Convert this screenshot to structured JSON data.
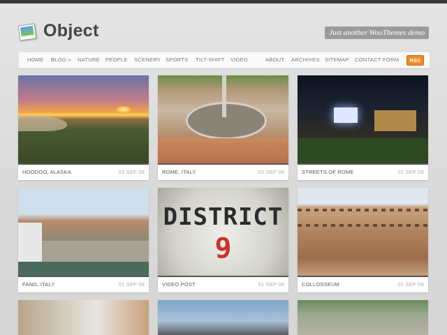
{
  "site": {
    "title": "Object",
    "tagline": "Just another WooThemes demo"
  },
  "nav": {
    "left": [
      "HOME",
      "BLOG »",
      "NATURE",
      "PEOPLE",
      "SCENERY",
      "SPORTS",
      "TILT-SHIFT",
      "VIDEO"
    ],
    "right": [
      "ABOUT",
      "ARCHIVES",
      "SITEMAP",
      "CONTACT FORM"
    ],
    "rss_label": "RSS"
  },
  "posts": [
    {
      "title": "HOODOO, ALASKA",
      "date": "03 SEP 09"
    },
    {
      "title": "ROME, ITALY",
      "date": "02 SEP 09"
    },
    {
      "title": "STREETS OF ROME",
      "date": "01 SEP 09"
    },
    {
      "title": "FANO, ITALY",
      "date": "01 SEP 09"
    },
    {
      "title": "VIDEO POST",
      "date": "01 SEP 09"
    },
    {
      "title": "COLLOSSEUM",
      "date": "01 SEP 09"
    }
  ],
  "video_thumb": {
    "line1": "DISTRICT",
    "line2": "9"
  },
  "colors": {
    "accent_rss": "#f08a24",
    "tagline_bg": "#9b9b9b",
    "caption_rule": "#555555"
  }
}
